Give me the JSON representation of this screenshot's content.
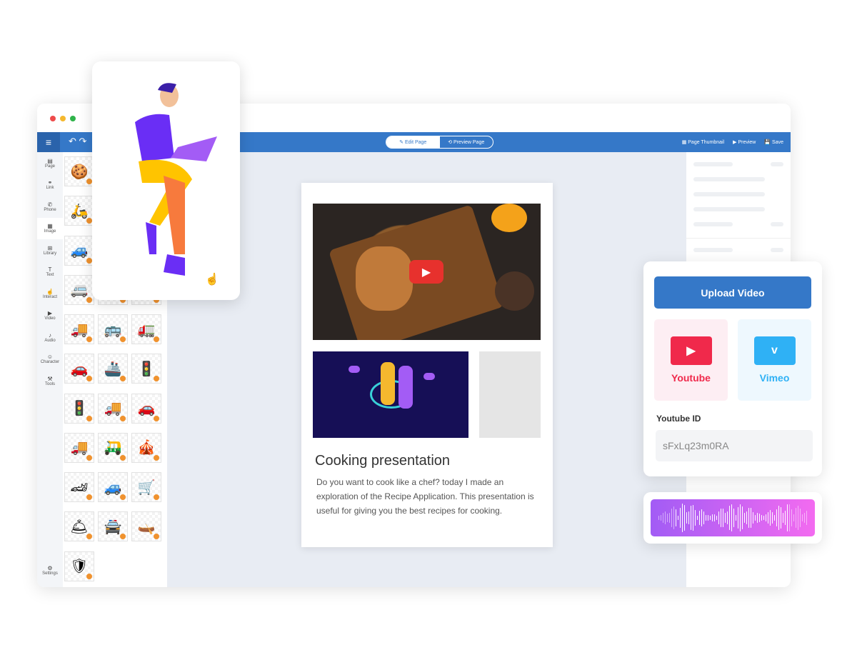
{
  "window": {
    "dot_colors": [
      "#ee4b4b",
      "#f5b82e",
      "#2fb34a"
    ]
  },
  "toolbar": {
    "menu_icon": "hamburger-icon",
    "undo_icon": "undo-icon",
    "redo_icon": "redo-icon",
    "edit_page": "Edit Page",
    "preview_page": "Preview Page",
    "page_thumbnail": "Page Thumbnail",
    "preview": "Preview",
    "save": "Save",
    "accent": "#3578c8"
  },
  "sidebar": {
    "items": [
      {
        "label": "Page",
        "icon": "▤"
      },
      {
        "label": "Link",
        "icon": "⚭"
      },
      {
        "label": "Phone",
        "icon": "✆"
      },
      {
        "label": "Image",
        "icon": "▦"
      },
      {
        "label": "Library",
        "icon": "⊞"
      },
      {
        "label": "Text",
        "icon": "T"
      },
      {
        "label": "Interact",
        "icon": "☝"
      },
      {
        "label": "Video",
        "icon": "▶"
      },
      {
        "label": "Audio",
        "icon": "♪"
      },
      {
        "label": "Character",
        "icon": "☺"
      },
      {
        "label": "Tools",
        "icon": "⚒"
      }
    ],
    "settings": {
      "label": "Settings",
      "icon": "⚙"
    }
  },
  "assets": [
    "🍪",
    "🏜",
    "🔴",
    "🛵",
    "🚘",
    "🚜",
    "🚙",
    "🚓",
    "🚑",
    "🚐",
    "➖",
    "🛵",
    "🚚",
    "🚌",
    "🚛",
    "🚗",
    "🚢",
    "🚦",
    "🚦",
    "🚚",
    "🚗",
    "🚚",
    "🛺",
    "🎪",
    "🏎",
    "🚙",
    "🛒",
    "🛎",
    "🚔",
    "🛶",
    "🛡"
  ],
  "page": {
    "title": "Cooking presentation",
    "description": "Do you want to cook like a chef? today I made an exploration of the Recipe Application. This presentation is useful for giving you the best recipes for cooking."
  },
  "video_panel": {
    "upload": "Upload Video",
    "youtube": "Youtube",
    "vimeo": "Vimeo",
    "youtube_id_label": "Youtube ID",
    "youtube_id_value": "sFxLq23m0RA",
    "youtube_color": "#f0294b",
    "vimeo_color": "#2fb1f5"
  }
}
